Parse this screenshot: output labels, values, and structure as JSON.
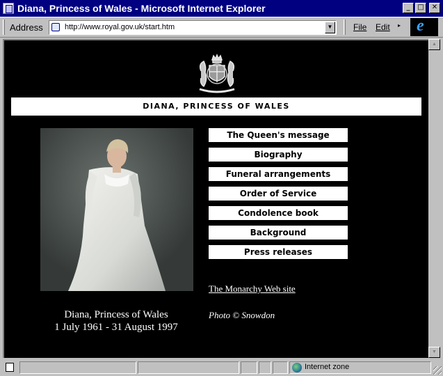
{
  "window": {
    "title": "Diana, Princess of Wales - Microsoft Internet Explorer",
    "minimize_glyph": "_",
    "maximize_glyph": "□",
    "close_glyph": "✕"
  },
  "toolbar": {
    "address_label": "Address",
    "url": "http://www.royal.gov.uk/start.htm",
    "menu_file": "File",
    "menu_edit": "Edit"
  },
  "page": {
    "banner": "DIANA, PRINCESS OF WALES",
    "nav": [
      {
        "label": "The Queen's message"
      },
      {
        "label": "Biography"
      },
      {
        "label": "Funeral arrangements"
      },
      {
        "label": "Order of Service"
      },
      {
        "label": "Condolence book"
      },
      {
        "label": "Background"
      },
      {
        "label": "Press releases"
      }
    ],
    "monarchy_link": "The Monarchy Web site",
    "caption_name": "Diana, Princess of Wales",
    "caption_dates": "1 July 1961 - 31 August 1997",
    "photo_credit": "Photo © Snowdon"
  },
  "statusbar": {
    "zone": "Internet zone"
  },
  "colors": {
    "title_bar": "#000080",
    "page_background": "#000000",
    "nav_button": "#ffffff"
  },
  "icons": [
    "page-icon",
    "ie-logo-icon",
    "royal-crest-icon",
    "internet-zone-icon"
  ]
}
